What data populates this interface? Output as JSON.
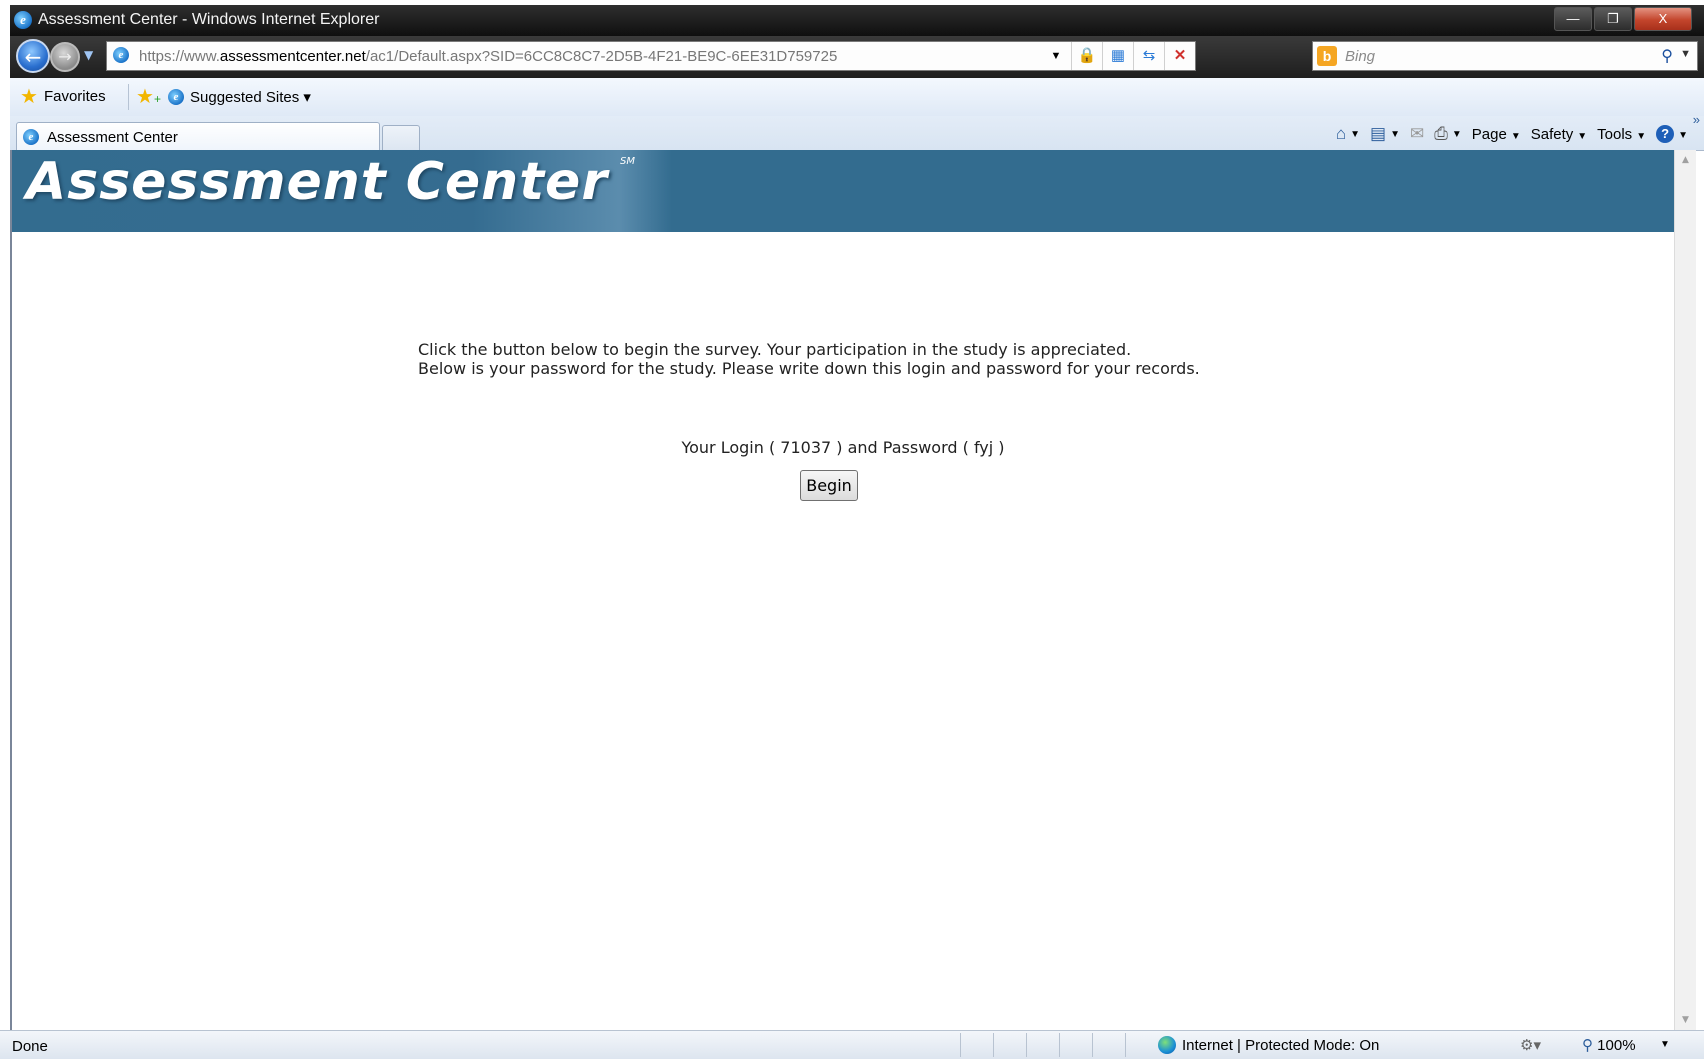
{
  "window": {
    "title": "Assessment Center - Windows Internet Explorer",
    "minimize_glyph": "—",
    "restore_glyph": "❐",
    "close_glyph": "X"
  },
  "address": {
    "url_scheme": "https://",
    "url_subdomain": "www.",
    "url_host": "assessmentcenter.net",
    "url_path": "/ac1/Default.aspx?SID=6CC8C8C7-2D5B-4F21-BE9C-6EE31D759725",
    "search_placeholder": "Bing",
    "bing_logo": "b"
  },
  "favorites": {
    "favorites_label": "Favorites",
    "suggested_sites_label": "Suggested Sites ▾"
  },
  "tabs": [
    {
      "label": "Assessment Center"
    }
  ],
  "commands": {
    "page_label": "Page",
    "safety_label": "Safety",
    "tools_label": "Tools",
    "help_glyph": "?",
    "more_glyph": "»"
  },
  "page": {
    "banner_title": "Assessment Center",
    "banner_mark": "SM",
    "message_line1": "Click the button below to begin the survey. Your participation in the study is appreciated.",
    "message_line2": "Below is your password for the study. Please write down this login and password for your records.",
    "login_text": "Your Login ( 71037 ) and Password ( fyj )",
    "begin_label": "Begin"
  },
  "status": {
    "text": "Done",
    "zone": "Internet | Protected Mode: On",
    "zoom": "100%"
  },
  "colors": {
    "banner": "#336c8f",
    "title_bar": "#1f1f1f"
  }
}
